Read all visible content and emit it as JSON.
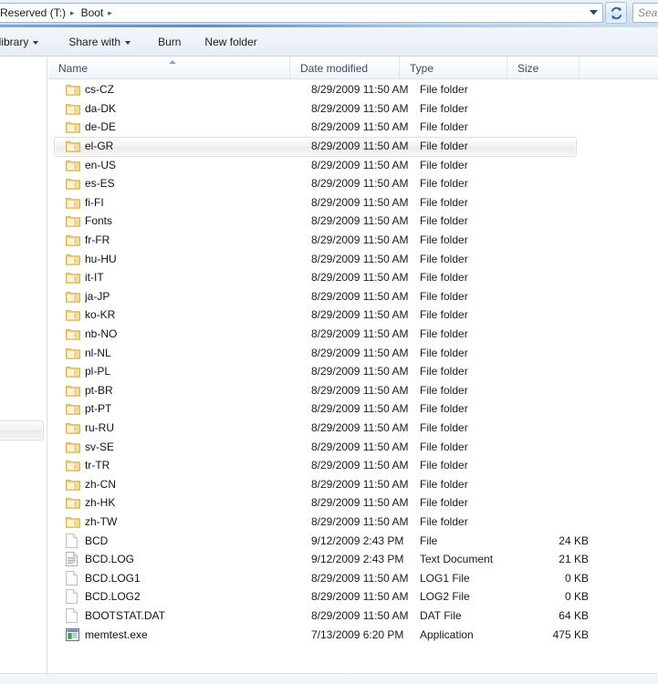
{
  "window": {
    "title": "Boot",
    "app": "Windows Explorer"
  },
  "address_bar": {
    "breadcrumbs": [
      {
        "label": "Reserved (T:)"
      },
      {
        "label": "Boot"
      }
    ],
    "separator": "▸",
    "dropdown_icon": "chevron-down-icon",
    "refresh_icon": "refresh-icon"
  },
  "search": {
    "placeholder": "Search Boot",
    "visible_text": "Sea",
    "value": ""
  },
  "toolbar": {
    "items": [
      {
        "label": "in library",
        "has_caret": true,
        "name": "include-in-library-button"
      },
      {
        "label": "Share with",
        "has_caret": true,
        "name": "share-with-button"
      },
      {
        "label": "Burn",
        "has_caret": false,
        "name": "burn-button"
      },
      {
        "label": "New folder",
        "has_caret": false,
        "name": "new-folder-button"
      }
    ]
  },
  "columns": {
    "name": "Name",
    "date_modified": "Date modified",
    "type": "Type",
    "size": "Size",
    "sort_column": "Name",
    "sort_direction": "ascending"
  },
  "colors": {
    "accent": "#5b8cc0",
    "folder": "#f5d88a",
    "header_text": "#3a4a5a",
    "row_text": "#111111",
    "hover_border": "#dedede"
  },
  "files": [
    {
      "name": "cs-CZ",
      "date": "8/29/2009 11:50 AM",
      "type": "File folder",
      "size": "",
      "icon": "folder-icon",
      "hovered": false
    },
    {
      "name": "da-DK",
      "date": "8/29/2009 11:50 AM",
      "type": "File folder",
      "size": "",
      "icon": "folder-icon",
      "hovered": false
    },
    {
      "name": "de-DE",
      "date": "8/29/2009 11:50 AM",
      "type": "File folder",
      "size": "",
      "icon": "folder-icon",
      "hovered": false
    },
    {
      "name": "el-GR",
      "date": "8/29/2009 11:50 AM",
      "type": "File folder",
      "size": "",
      "icon": "folder-icon",
      "hovered": true
    },
    {
      "name": "en-US",
      "date": "8/29/2009 11:50 AM",
      "type": "File folder",
      "size": "",
      "icon": "folder-icon",
      "hovered": false
    },
    {
      "name": "es-ES",
      "date": "8/29/2009 11:50 AM",
      "type": "File folder",
      "size": "",
      "icon": "folder-icon",
      "hovered": false
    },
    {
      "name": "fi-FI",
      "date": "8/29/2009 11:50 AM",
      "type": "File folder",
      "size": "",
      "icon": "folder-icon",
      "hovered": false
    },
    {
      "name": "Fonts",
      "date": "8/29/2009 11:50 AM",
      "type": "File folder",
      "size": "",
      "icon": "folder-icon",
      "hovered": false
    },
    {
      "name": "fr-FR",
      "date": "8/29/2009 11:50 AM",
      "type": "File folder",
      "size": "",
      "icon": "folder-icon",
      "hovered": false
    },
    {
      "name": "hu-HU",
      "date": "8/29/2009 11:50 AM",
      "type": "File folder",
      "size": "",
      "icon": "folder-icon",
      "hovered": false
    },
    {
      "name": "it-IT",
      "date": "8/29/2009 11:50 AM",
      "type": "File folder",
      "size": "",
      "icon": "folder-icon",
      "hovered": false
    },
    {
      "name": "ja-JP",
      "date": "8/29/2009 11:50 AM",
      "type": "File folder",
      "size": "",
      "icon": "folder-icon",
      "hovered": false
    },
    {
      "name": "ko-KR",
      "date": "8/29/2009 11:50 AM",
      "type": "File folder",
      "size": "",
      "icon": "folder-icon",
      "hovered": false
    },
    {
      "name": "nb-NO",
      "date": "8/29/2009 11:50 AM",
      "type": "File folder",
      "size": "",
      "icon": "folder-icon",
      "hovered": false
    },
    {
      "name": "nl-NL",
      "date": "8/29/2009 11:50 AM",
      "type": "File folder",
      "size": "",
      "icon": "folder-icon",
      "hovered": false
    },
    {
      "name": "pl-PL",
      "date": "8/29/2009 11:50 AM",
      "type": "File folder",
      "size": "",
      "icon": "folder-icon",
      "hovered": false
    },
    {
      "name": "pt-BR",
      "date": "8/29/2009 11:50 AM",
      "type": "File folder",
      "size": "",
      "icon": "folder-icon",
      "hovered": false
    },
    {
      "name": "pt-PT",
      "date": "8/29/2009 11:50 AM",
      "type": "File folder",
      "size": "",
      "icon": "folder-icon",
      "hovered": false
    },
    {
      "name": "ru-RU",
      "date": "8/29/2009 11:50 AM",
      "type": "File folder",
      "size": "",
      "icon": "folder-icon",
      "hovered": false
    },
    {
      "name": "sv-SE",
      "date": "8/29/2009 11:50 AM",
      "type": "File folder",
      "size": "",
      "icon": "folder-icon",
      "hovered": false
    },
    {
      "name": "tr-TR",
      "date": "8/29/2009 11:50 AM",
      "type": "File folder",
      "size": "",
      "icon": "folder-icon",
      "hovered": false
    },
    {
      "name": "zh-CN",
      "date": "8/29/2009 11:50 AM",
      "type": "File folder",
      "size": "",
      "icon": "folder-icon",
      "hovered": false
    },
    {
      "name": "zh-HK",
      "date": "8/29/2009 11:50 AM",
      "type": "File folder",
      "size": "",
      "icon": "folder-icon",
      "hovered": false
    },
    {
      "name": "zh-TW",
      "date": "8/29/2009 11:50 AM",
      "type": "File folder",
      "size": "",
      "icon": "folder-icon",
      "hovered": false
    },
    {
      "name": "BCD",
      "date": "9/12/2009 2:43 PM",
      "type": "File",
      "size": "24 KB",
      "icon": "blank-file-icon",
      "hovered": false
    },
    {
      "name": "BCD.LOG",
      "date": "9/12/2009 2:43 PM",
      "type": "Text Document",
      "size": "21 KB",
      "icon": "text-document-icon",
      "hovered": false
    },
    {
      "name": "BCD.LOG1",
      "date": "8/29/2009 11:50 AM",
      "type": "LOG1 File",
      "size": "0 KB",
      "icon": "blank-file-icon",
      "hovered": false
    },
    {
      "name": "BCD.LOG2",
      "date": "8/29/2009 11:50 AM",
      "type": "LOG2 File",
      "size": "0 KB",
      "icon": "blank-file-icon",
      "hovered": false
    },
    {
      "name": "BOOTSTAT.DAT",
      "date": "8/29/2009 11:50 AM",
      "type": "DAT File",
      "size": "64 KB",
      "icon": "blank-file-icon",
      "hovered": false
    },
    {
      "name": "memtest.exe",
      "date": "7/13/2009 6:20 PM",
      "type": "Application",
      "size": "475 KB",
      "icon": "application-icon",
      "hovered": false
    }
  ]
}
